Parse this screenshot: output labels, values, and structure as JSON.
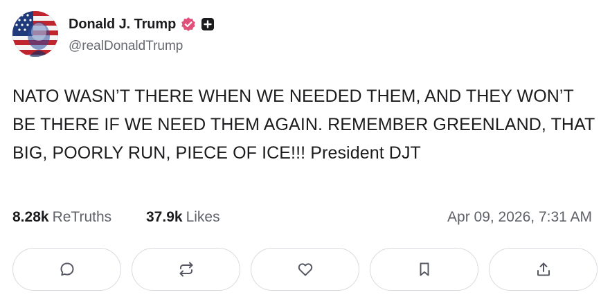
{
  "author": {
    "display_name": "Donald J. Trump",
    "handle": "@realDonaldTrump",
    "verified_icon": "verified-badge-icon",
    "plus_icon": "plus-badge-icon",
    "verified_color": "#e0507a"
  },
  "post": {
    "text": "NATO WASN’T THERE WHEN WE NEEDED THEM, AND THEY WON’T BE THERE IF WE NEED THEM AGAIN. REMEMBER GREENLAND, THAT BIG, POORLY RUN, PIECE OF ICE!!! President DJT"
  },
  "stats": {
    "retruths_count": "8.28k",
    "retruths_label": "ReTruths",
    "likes_count": "37.9k",
    "likes_label": "Likes",
    "timestamp": "Apr 09, 2026, 7:31 AM"
  },
  "actions": [
    {
      "name": "reply",
      "icon": "comment-icon"
    },
    {
      "name": "retruth",
      "icon": "repost-icon"
    },
    {
      "name": "like",
      "icon": "heart-icon"
    },
    {
      "name": "bookmark",
      "icon": "bookmark-icon"
    },
    {
      "name": "share",
      "icon": "share-icon"
    }
  ]
}
